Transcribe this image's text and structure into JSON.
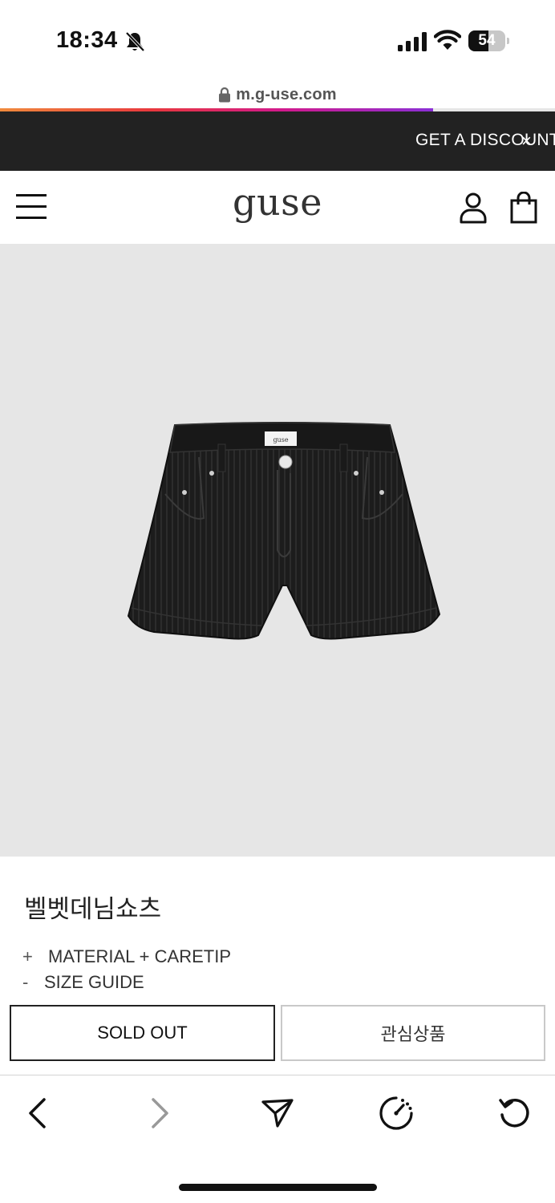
{
  "status_bar": {
    "time": "18:34",
    "battery_level": "54",
    "battery_fraction": 0.54,
    "icons": [
      "bell-slash-icon",
      "cellular-signal-icon",
      "wifi-icon",
      "battery-icon"
    ]
  },
  "browser": {
    "url": "m.g-use.com",
    "load_progress": 0.78,
    "toolbar_icons": [
      "back-icon",
      "forward-icon",
      "share-icon",
      "speed-icon",
      "reload-icon"
    ]
  },
  "promo": {
    "text": "GET A DISCOUNT",
    "close": "×"
  },
  "header": {
    "logo": "guse",
    "icons": [
      "menu-icon",
      "user-icon",
      "shopping-bag-icon"
    ]
  },
  "product": {
    "name": "벨벳데님쇼츠",
    "label_tag": "guse",
    "material_symbol": "+",
    "material_label": "MATERIAL + CARETIP",
    "size_symbol": "-",
    "size_label": "SIZE GUIDE",
    "sold_out_label": "SOLD OUT",
    "wishlist_label": "관심상품"
  },
  "colors": {
    "banner_bg": "#222222",
    "image_bg": "#e6e6e6",
    "accent_gradient": [
      "#f08a3c",
      "#e8383d",
      "#d21a8c",
      "#8b2fd6"
    ]
  }
}
